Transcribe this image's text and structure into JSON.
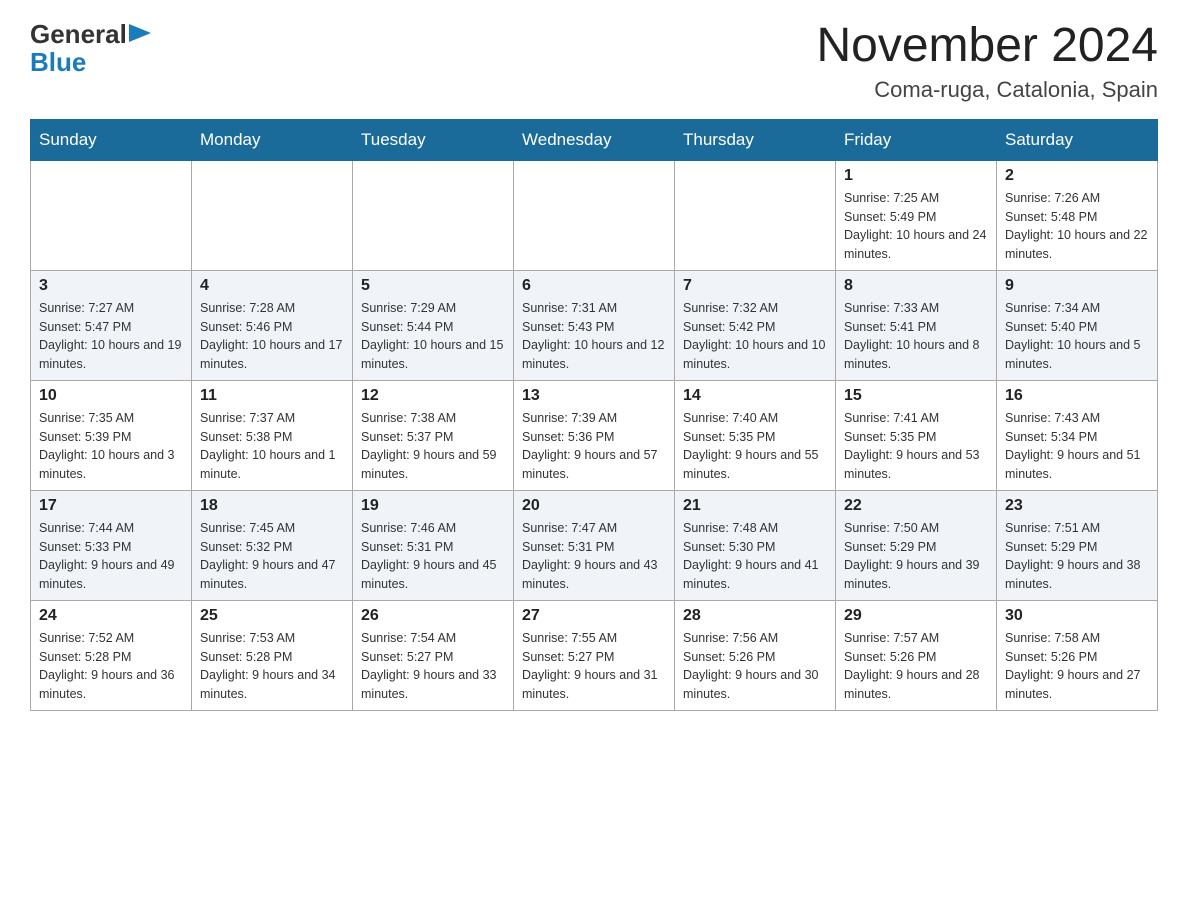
{
  "header": {
    "logo_general": "General",
    "logo_blue": "Blue",
    "month_title": "November 2024",
    "subtitle": "Coma-ruga, Catalonia, Spain"
  },
  "weekdays": [
    "Sunday",
    "Monday",
    "Tuesday",
    "Wednesday",
    "Thursday",
    "Friday",
    "Saturday"
  ],
  "weeks": [
    [
      {
        "day": "",
        "info": ""
      },
      {
        "day": "",
        "info": ""
      },
      {
        "day": "",
        "info": ""
      },
      {
        "day": "",
        "info": ""
      },
      {
        "day": "",
        "info": ""
      },
      {
        "day": "1",
        "info": "Sunrise: 7:25 AM\nSunset: 5:49 PM\nDaylight: 10 hours and 24 minutes."
      },
      {
        "day": "2",
        "info": "Sunrise: 7:26 AM\nSunset: 5:48 PM\nDaylight: 10 hours and 22 minutes."
      }
    ],
    [
      {
        "day": "3",
        "info": "Sunrise: 7:27 AM\nSunset: 5:47 PM\nDaylight: 10 hours and 19 minutes."
      },
      {
        "day": "4",
        "info": "Sunrise: 7:28 AM\nSunset: 5:46 PM\nDaylight: 10 hours and 17 minutes."
      },
      {
        "day": "5",
        "info": "Sunrise: 7:29 AM\nSunset: 5:44 PM\nDaylight: 10 hours and 15 minutes."
      },
      {
        "day": "6",
        "info": "Sunrise: 7:31 AM\nSunset: 5:43 PM\nDaylight: 10 hours and 12 minutes."
      },
      {
        "day": "7",
        "info": "Sunrise: 7:32 AM\nSunset: 5:42 PM\nDaylight: 10 hours and 10 minutes."
      },
      {
        "day": "8",
        "info": "Sunrise: 7:33 AM\nSunset: 5:41 PM\nDaylight: 10 hours and 8 minutes."
      },
      {
        "day": "9",
        "info": "Sunrise: 7:34 AM\nSunset: 5:40 PM\nDaylight: 10 hours and 5 minutes."
      }
    ],
    [
      {
        "day": "10",
        "info": "Sunrise: 7:35 AM\nSunset: 5:39 PM\nDaylight: 10 hours and 3 minutes."
      },
      {
        "day": "11",
        "info": "Sunrise: 7:37 AM\nSunset: 5:38 PM\nDaylight: 10 hours and 1 minute."
      },
      {
        "day": "12",
        "info": "Sunrise: 7:38 AM\nSunset: 5:37 PM\nDaylight: 9 hours and 59 minutes."
      },
      {
        "day": "13",
        "info": "Sunrise: 7:39 AM\nSunset: 5:36 PM\nDaylight: 9 hours and 57 minutes."
      },
      {
        "day": "14",
        "info": "Sunrise: 7:40 AM\nSunset: 5:35 PM\nDaylight: 9 hours and 55 minutes."
      },
      {
        "day": "15",
        "info": "Sunrise: 7:41 AM\nSunset: 5:35 PM\nDaylight: 9 hours and 53 minutes."
      },
      {
        "day": "16",
        "info": "Sunrise: 7:43 AM\nSunset: 5:34 PM\nDaylight: 9 hours and 51 minutes."
      }
    ],
    [
      {
        "day": "17",
        "info": "Sunrise: 7:44 AM\nSunset: 5:33 PM\nDaylight: 9 hours and 49 minutes."
      },
      {
        "day": "18",
        "info": "Sunrise: 7:45 AM\nSunset: 5:32 PM\nDaylight: 9 hours and 47 minutes."
      },
      {
        "day": "19",
        "info": "Sunrise: 7:46 AM\nSunset: 5:31 PM\nDaylight: 9 hours and 45 minutes."
      },
      {
        "day": "20",
        "info": "Sunrise: 7:47 AM\nSunset: 5:31 PM\nDaylight: 9 hours and 43 minutes."
      },
      {
        "day": "21",
        "info": "Sunrise: 7:48 AM\nSunset: 5:30 PM\nDaylight: 9 hours and 41 minutes."
      },
      {
        "day": "22",
        "info": "Sunrise: 7:50 AM\nSunset: 5:29 PM\nDaylight: 9 hours and 39 minutes."
      },
      {
        "day": "23",
        "info": "Sunrise: 7:51 AM\nSunset: 5:29 PM\nDaylight: 9 hours and 38 minutes."
      }
    ],
    [
      {
        "day": "24",
        "info": "Sunrise: 7:52 AM\nSunset: 5:28 PM\nDaylight: 9 hours and 36 minutes."
      },
      {
        "day": "25",
        "info": "Sunrise: 7:53 AM\nSunset: 5:28 PM\nDaylight: 9 hours and 34 minutes."
      },
      {
        "day": "26",
        "info": "Sunrise: 7:54 AM\nSunset: 5:27 PM\nDaylight: 9 hours and 33 minutes."
      },
      {
        "day": "27",
        "info": "Sunrise: 7:55 AM\nSunset: 5:27 PM\nDaylight: 9 hours and 31 minutes."
      },
      {
        "day": "28",
        "info": "Sunrise: 7:56 AM\nSunset: 5:26 PM\nDaylight: 9 hours and 30 minutes."
      },
      {
        "day": "29",
        "info": "Sunrise: 7:57 AM\nSunset: 5:26 PM\nDaylight: 9 hours and 28 minutes."
      },
      {
        "day": "30",
        "info": "Sunrise: 7:58 AM\nSunset: 5:26 PM\nDaylight: 9 hours and 27 minutes."
      }
    ]
  ]
}
